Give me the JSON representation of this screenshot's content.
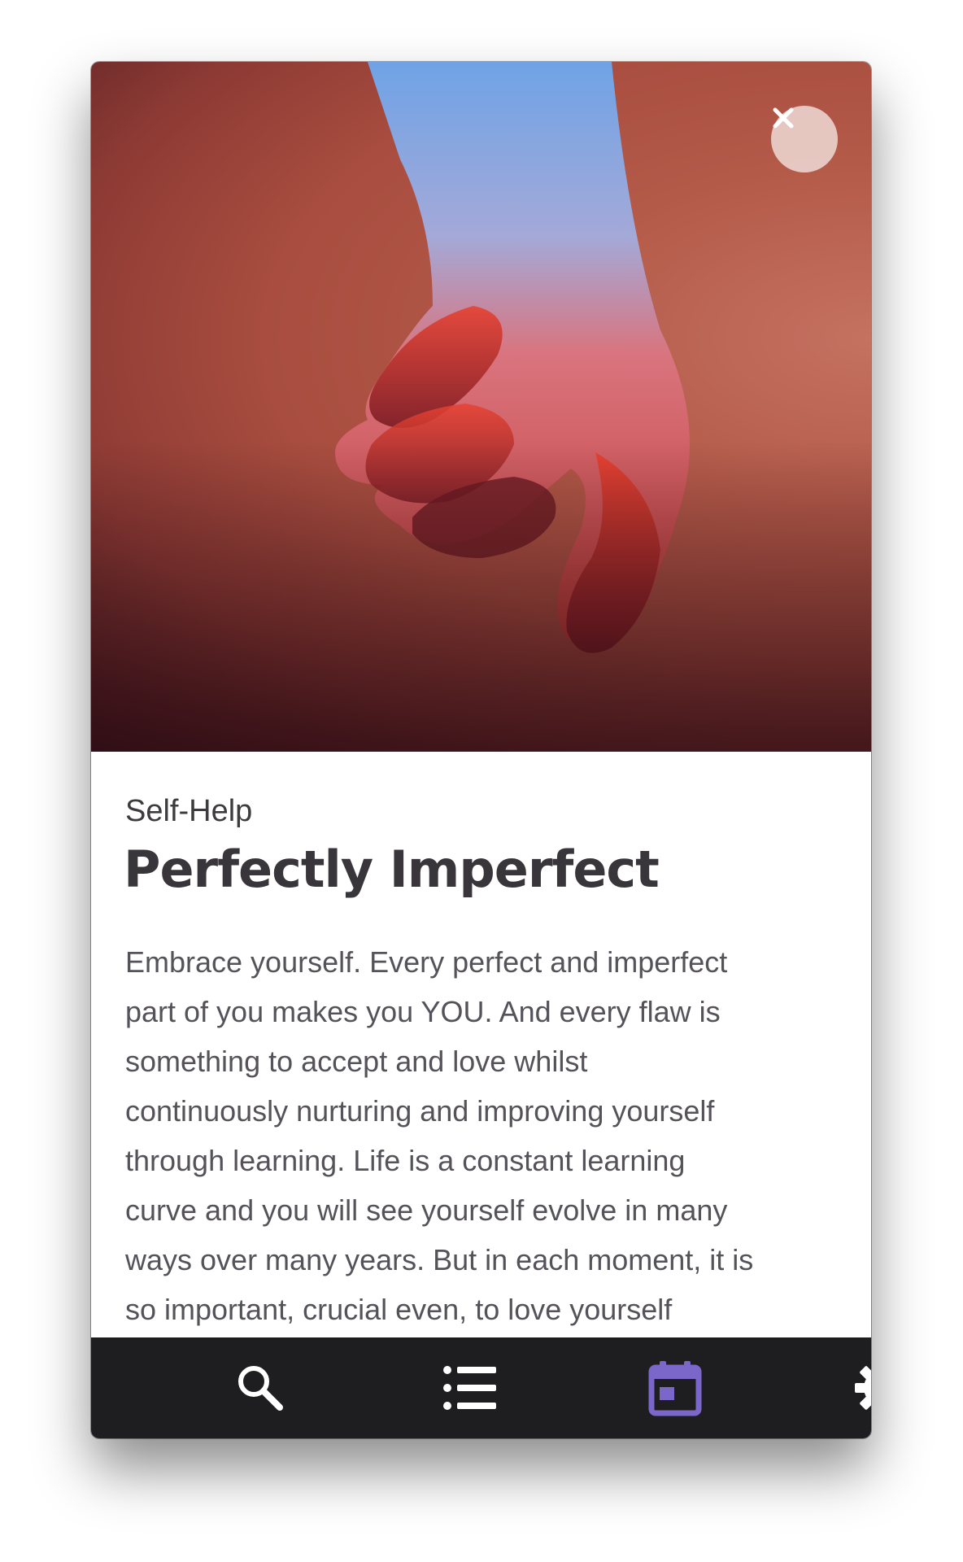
{
  "article": {
    "category": "Self-Help",
    "title": "Perfectly Imperfect",
    "body_lines": [
      "Embrace yourself. Every perfect and imperfect",
      "part of you makes you YOU. And every flaw is",
      "something to accept and love whilst",
      "continuously nurturing and improving yourself",
      "through learning. Life is a constant learning",
      "curve and you will see yourself evolve in many",
      "ways over many years. But in each moment, it is",
      "so important, crucial even, to love yourself"
    ]
  },
  "hero": {
    "image": "hand-illustration"
  },
  "controls": {
    "close_icon": "close-icon"
  },
  "tabbar": {
    "tabs": [
      {
        "icon": "search-icon",
        "active": false
      },
      {
        "icon": "list-icon",
        "active": false
      },
      {
        "icon": "calendar-icon",
        "active": true
      },
      {
        "icon": "gear-icon",
        "active": false
      }
    ]
  },
  "colors": {
    "accent": "#7b66c9",
    "tabbar_bg": "#1e1e20",
    "tab_icon": "#ffffff",
    "title_text": "#38363a",
    "body_text": "#555359",
    "close_button_bg": "#eedad6"
  }
}
